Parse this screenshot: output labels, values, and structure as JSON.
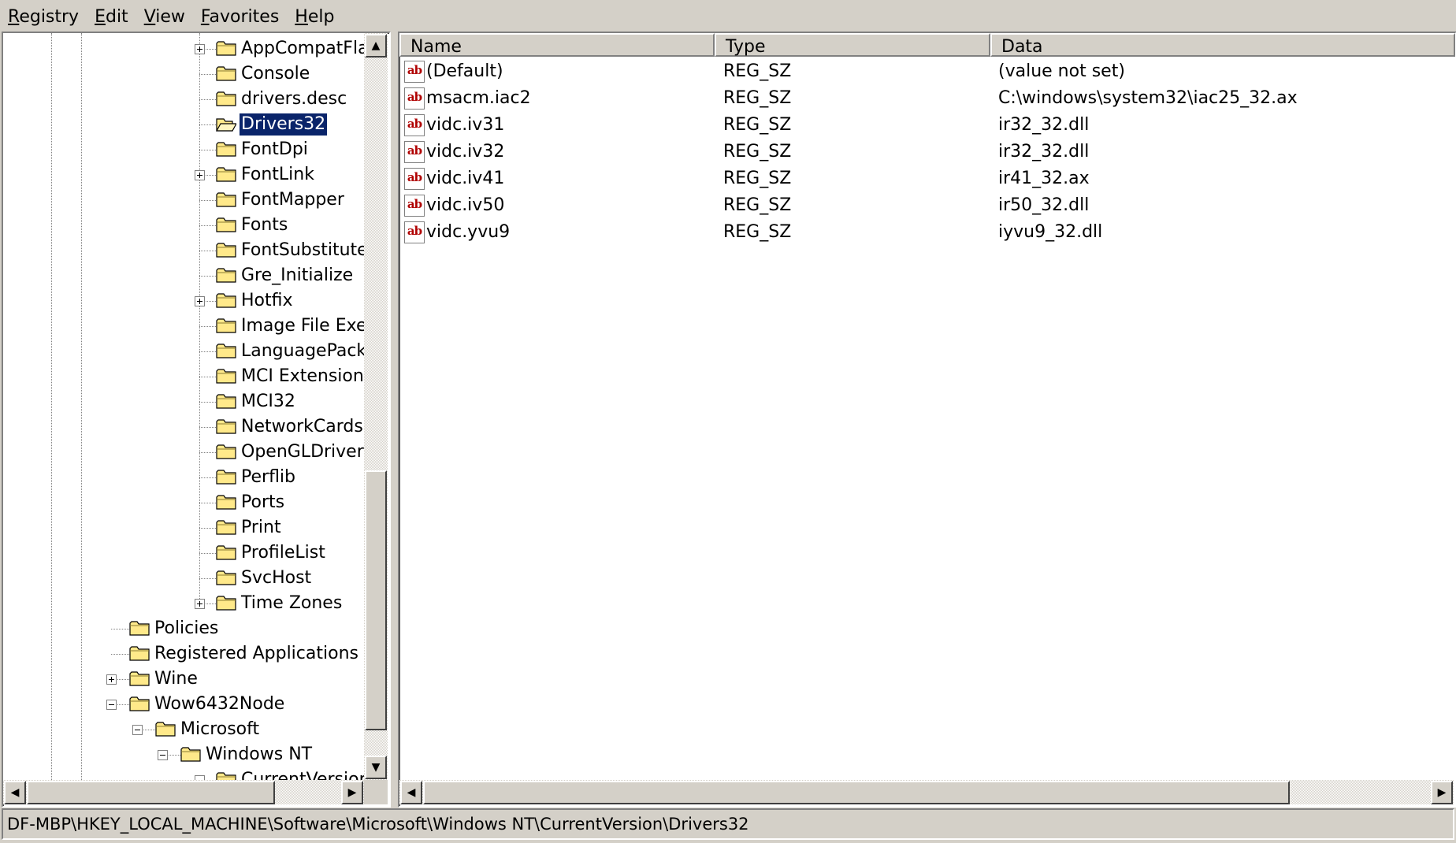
{
  "menu": [
    {
      "label": "Registry",
      "mnemonic": "R",
      "rest": "egistry"
    },
    {
      "label": "Edit",
      "mnemonic": "E",
      "rest": "dit"
    },
    {
      "label": "View",
      "mnemonic": "V",
      "rest": "iew"
    },
    {
      "label": "Favorites",
      "mnemonic": "F",
      "rest": "avorites"
    },
    {
      "label": "Help",
      "mnemonic": "H",
      "rest": "elp"
    }
  ],
  "tree": {
    "items": [
      {
        "label": "AppCompatFlags",
        "level": 3,
        "expander": "plus",
        "selected": false
      },
      {
        "label": "Console",
        "level": 3,
        "expander": null,
        "selected": false
      },
      {
        "label": "drivers.desc",
        "level": 3,
        "expander": null,
        "selected": false
      },
      {
        "label": "Drivers32",
        "level": 3,
        "expander": null,
        "selected": true
      },
      {
        "label": "FontDpi",
        "level": 3,
        "expander": null,
        "selected": false
      },
      {
        "label": "FontLink",
        "level": 3,
        "expander": "plus",
        "selected": false
      },
      {
        "label": "FontMapper",
        "level": 3,
        "expander": null,
        "selected": false
      },
      {
        "label": "Fonts",
        "level": 3,
        "expander": null,
        "selected": false
      },
      {
        "label": "FontSubstitutes",
        "level": 3,
        "expander": null,
        "selected": false
      },
      {
        "label": "Gre_Initialize",
        "level": 3,
        "expander": null,
        "selected": false
      },
      {
        "label": "Hotfix",
        "level": 3,
        "expander": "plus",
        "selected": false
      },
      {
        "label": "Image File Execution Options",
        "level": 3,
        "expander": null,
        "selected": false
      },
      {
        "label": "LanguagePack",
        "level": 3,
        "expander": null,
        "selected": false
      },
      {
        "label": "MCI Extensions",
        "level": 3,
        "expander": null,
        "selected": false
      },
      {
        "label": "MCI32",
        "level": 3,
        "expander": null,
        "selected": false
      },
      {
        "label": "NetworkCards",
        "level": 3,
        "expander": null,
        "selected": false
      },
      {
        "label": "OpenGLDrivers",
        "level": 3,
        "expander": null,
        "selected": false
      },
      {
        "label": "Perflib",
        "level": 3,
        "expander": null,
        "selected": false
      },
      {
        "label": "Ports",
        "level": 3,
        "expander": null,
        "selected": false
      },
      {
        "label": "Print",
        "level": 3,
        "expander": null,
        "selected": false
      },
      {
        "label": "ProfileList",
        "level": 3,
        "expander": null,
        "selected": false
      },
      {
        "label": "SvcHost",
        "level": 3,
        "expander": null,
        "selected": false
      },
      {
        "label": "Time Zones",
        "level": 3,
        "expander": "plus",
        "selected": false
      },
      {
        "label": "Policies",
        "level": 0,
        "expander": null,
        "selected": false
      },
      {
        "label": "Registered Applications",
        "level": 0,
        "expander": null,
        "selected": false
      },
      {
        "label": "Wine",
        "level": 0,
        "expander": "plus",
        "selected": false
      },
      {
        "label": "Wow6432Node",
        "level": 0,
        "expander": "minus",
        "selected": false
      },
      {
        "label": "Microsoft",
        "level": 1,
        "expander": "minus",
        "selected": false
      },
      {
        "label": "Windows NT",
        "level": 2,
        "expander": "minus",
        "selected": false
      },
      {
        "label": "CurrentVersion",
        "level": 3,
        "expander": "minus",
        "selected": false
      }
    ]
  },
  "list": {
    "columns": [
      {
        "label": "Name"
      },
      {
        "label": "Type"
      },
      {
        "label": "Data"
      }
    ],
    "icon_text": "ab",
    "rows": [
      {
        "name": "(Default)",
        "type": "REG_SZ",
        "data": "(value not set)"
      },
      {
        "name": "msacm.iac2",
        "type": "REG_SZ",
        "data": "C:\\windows\\system32\\iac25_32.ax"
      },
      {
        "name": "vidc.iv31",
        "type": "REG_SZ",
        "data": "ir32_32.dll"
      },
      {
        "name": "vidc.iv32",
        "type": "REG_SZ",
        "data": "ir32_32.dll"
      },
      {
        "name": "vidc.iv41",
        "type": "REG_SZ",
        "data": "ir41_32.ax"
      },
      {
        "name": "vidc.iv50",
        "type": "REG_SZ",
        "data": "ir50_32.dll"
      },
      {
        "name": "vidc.yvu9",
        "type": "REG_SZ",
        "data": "iyvu9_32.dll"
      }
    ]
  },
  "status": {
    "path": "DF-MBP\\HKEY_LOCAL_MACHINE\\Software\\Microsoft\\Windows NT\\CurrentVersion\\Drivers32"
  },
  "colors": {
    "selection": "#0a246a",
    "folder": "#ffe98a",
    "icon_text": "#b00000"
  }
}
